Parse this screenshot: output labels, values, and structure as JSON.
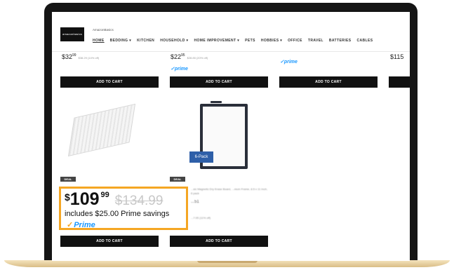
{
  "header": {
    "logo_text": "amazonbasics",
    "brand_name": "AmazonBasics",
    "nav": [
      {
        "label": "HOME",
        "active": true
      },
      {
        "label": "BEDDING ▾"
      },
      {
        "label": "KITCHEN"
      },
      {
        "label": "HOUSEHOLD ▾"
      },
      {
        "label": "HOME IMPROVEMENT ▾"
      },
      {
        "label": "PETS"
      },
      {
        "label": "HOBBIES ▾"
      },
      {
        "label": "OFFICE"
      },
      {
        "label": "TRAVEL"
      },
      {
        "label": "BATTERIES"
      },
      {
        "label": "CABLES"
      }
    ]
  },
  "products_row1": [
    {
      "price_dollars": "$32",
      "price_cents": "99",
      "old_price": "$38.29 (14% off)",
      "prime": ""
    },
    {
      "price_dollars": "$22",
      "price_cents": "95",
      "old_price": "$28.85 (20% off)",
      "prime": "✓prime"
    },
    {
      "price_dollars": "",
      "price_cents": "",
      "old_price": "",
      "prime": "✓prime"
    },
    {
      "price_dollars": "$115",
      "price_cents": "",
      "old_price": "",
      "prime": ""
    }
  ],
  "add_to_cart_label": "ADD TO CART",
  "deal_label": "DEAL",
  "pack_badge": "6-Pack",
  "blurred_title": "...sic Magnetic Dry Erase Board, ...nium Frame, 8.5 x 11 Inch, 6 pack",
  "blurred_price": "...51",
  "blurred_old": "...7.05 (11% off)",
  "callout": {
    "currency": "$",
    "dollars": "109",
    "cents": "99",
    "was_price": "$134.99",
    "savings": "includes $25.00 Prime savings",
    "prime_check": "✓",
    "prime_label": "Prime"
  },
  "colors": {
    "highlight": "#f5a623",
    "prime_blue": "#1a98ff",
    "bezel": "#151515"
  }
}
